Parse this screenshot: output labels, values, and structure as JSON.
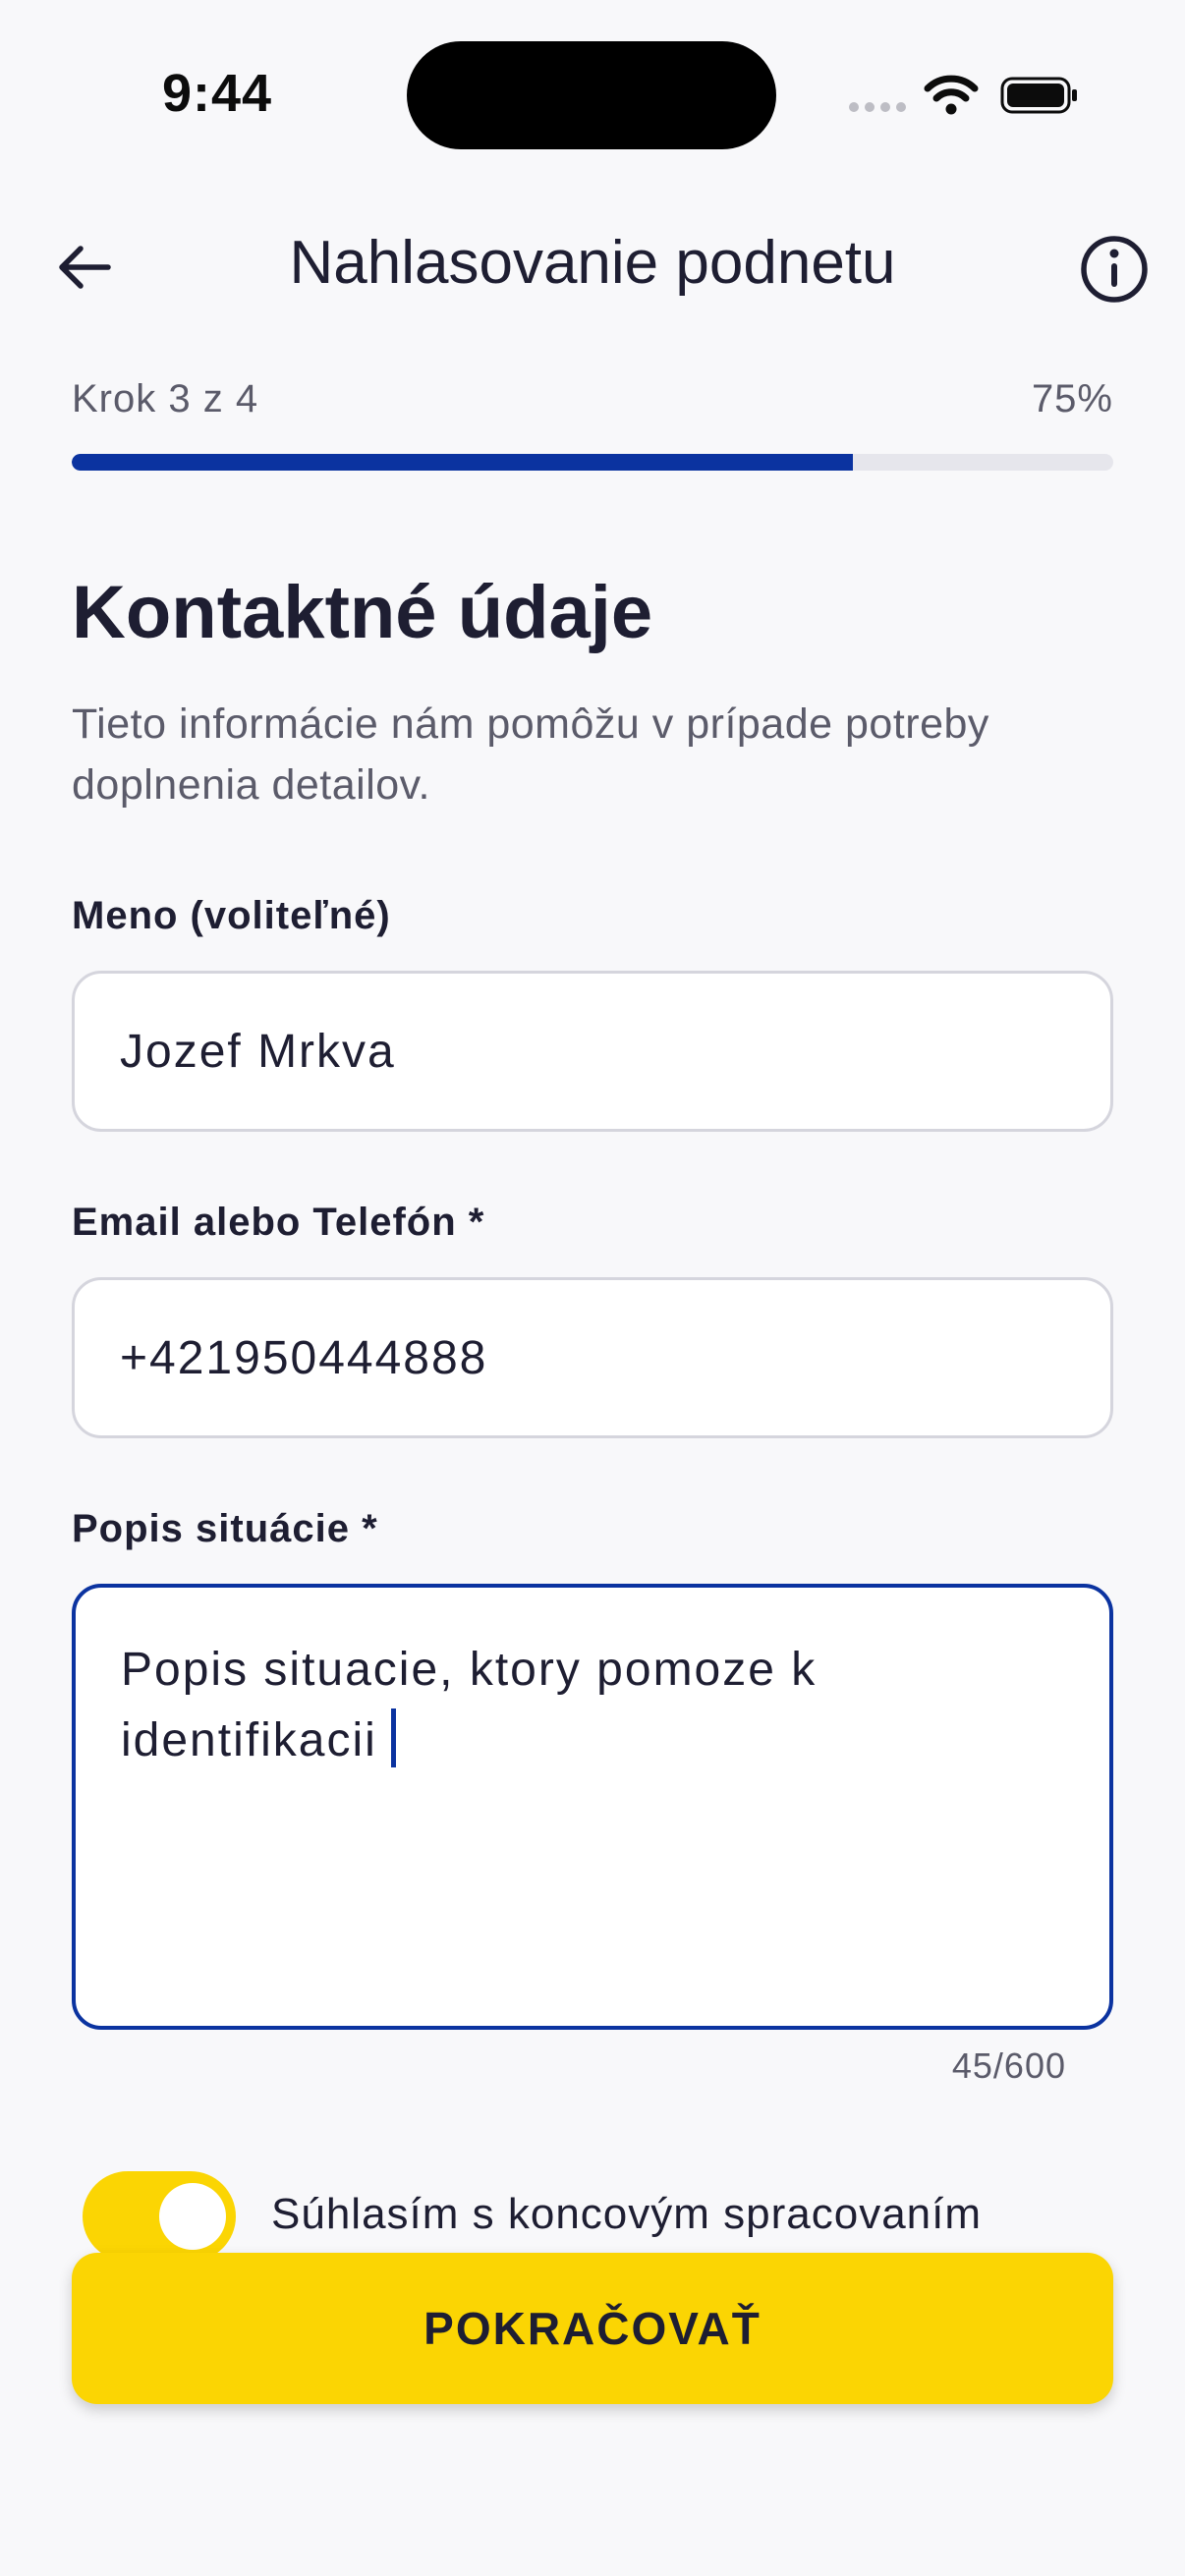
{
  "status_bar": {
    "time": "9:44"
  },
  "header": {
    "title": "Nahlasovanie podnetu"
  },
  "progress": {
    "step_text": "Krok 3 z 4",
    "percent_text": "75%",
    "fraction": 0.75
  },
  "section": {
    "title": "Kontaktné údaje",
    "subtitle": "Tieto informácie nám pomôžu v prípade potreby doplnenia detailov."
  },
  "form": {
    "name": {
      "label": "Meno (voliteľné)",
      "value": "Jozef Mrkva"
    },
    "contact": {
      "label": "Email alebo Telefón *",
      "value": "+421950444888"
    },
    "description": {
      "label": "Popis situácie *",
      "value": "Popis situacie, ktory pomoze k identifikacii",
      "counter": "45/600"
    },
    "consent": {
      "text": "Súhlasím s koncovým spracovaním osobných údajov",
      "checked": true
    }
  },
  "cta": {
    "label": "POKRAČOVAŤ"
  },
  "colors": {
    "accent": "#0b33a0",
    "primary_button": "#fbd503",
    "background": "#f8f8fa"
  }
}
